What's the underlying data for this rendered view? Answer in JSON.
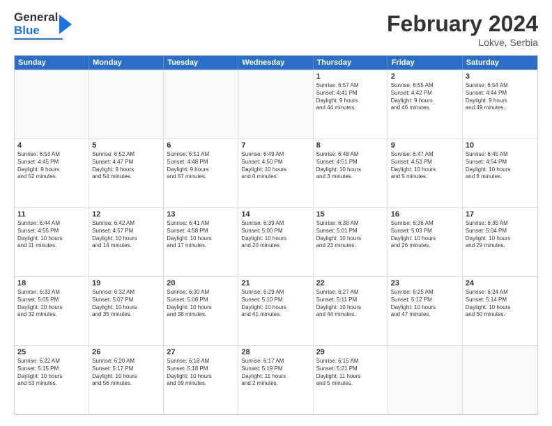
{
  "header": {
    "logo_general": "General",
    "logo_blue": "Blue",
    "main_title": "February 2024",
    "subtitle": "Lokve, Serbia"
  },
  "calendar": {
    "days": [
      "Sunday",
      "Monday",
      "Tuesday",
      "Wednesday",
      "Thursday",
      "Friday",
      "Saturday"
    ],
    "rows": [
      [
        {
          "day": "",
          "empty": true,
          "info": ""
        },
        {
          "day": "",
          "empty": true,
          "info": ""
        },
        {
          "day": "",
          "empty": true,
          "info": ""
        },
        {
          "day": "",
          "empty": true,
          "info": ""
        },
        {
          "day": "1",
          "info": "Sunrise: 6:57 AM\nSunset: 4:41 PM\nDaylight: 9 hours\nand 44 minutes."
        },
        {
          "day": "2",
          "info": "Sunrise: 6:55 AM\nSunset: 4:42 PM\nDaylight: 9 hours\nand 46 minutes."
        },
        {
          "day": "3",
          "info": "Sunrise: 6:54 AM\nSunset: 4:44 PM\nDaylight: 9 hours\nand 49 minutes."
        }
      ],
      [
        {
          "day": "4",
          "info": "Sunrise: 6:53 AM\nSunset: 4:45 PM\nDaylight: 9 hours\nand 52 minutes."
        },
        {
          "day": "5",
          "info": "Sunrise: 6:52 AM\nSunset: 4:47 PM\nDaylight: 9 hours\nand 54 minutes."
        },
        {
          "day": "6",
          "info": "Sunrise: 6:51 AM\nSunset: 4:48 PM\nDaylight: 9 hours\nand 57 minutes."
        },
        {
          "day": "7",
          "info": "Sunrise: 6:49 AM\nSunset: 4:50 PM\nDaylight: 10 hours\nand 0 minutes."
        },
        {
          "day": "8",
          "info": "Sunrise: 6:48 AM\nSunset: 4:51 PM\nDaylight: 10 hours\nand 3 minutes."
        },
        {
          "day": "9",
          "info": "Sunrise: 6:47 AM\nSunset: 4:53 PM\nDaylight: 10 hours\nand 5 minutes."
        },
        {
          "day": "10",
          "info": "Sunrise: 6:45 AM\nSunset: 4:54 PM\nDaylight: 10 hours\nand 8 minutes."
        }
      ],
      [
        {
          "day": "11",
          "info": "Sunrise: 6:44 AM\nSunset: 4:55 PM\nDaylight: 10 hours\nand 11 minutes."
        },
        {
          "day": "12",
          "info": "Sunrise: 6:42 AM\nSunset: 4:57 PM\nDaylight: 10 hours\nand 14 minutes."
        },
        {
          "day": "13",
          "info": "Sunrise: 6:41 AM\nSunset: 4:58 PM\nDaylight: 10 hours\nand 17 minutes."
        },
        {
          "day": "14",
          "info": "Sunrise: 6:39 AM\nSunset: 5:00 PM\nDaylight: 10 hours\nand 20 minutes."
        },
        {
          "day": "15",
          "info": "Sunrise: 6:38 AM\nSunset: 5:01 PM\nDaylight: 10 hours\nand 23 minutes."
        },
        {
          "day": "16",
          "info": "Sunrise: 6:36 AM\nSunset: 5:03 PM\nDaylight: 10 hours\nand 26 minutes."
        },
        {
          "day": "17",
          "info": "Sunrise: 6:35 AM\nSunset: 5:04 PM\nDaylight: 10 hours\nand 29 minutes."
        }
      ],
      [
        {
          "day": "18",
          "info": "Sunrise: 6:33 AM\nSunset: 5:05 PM\nDaylight: 10 hours\nand 32 minutes."
        },
        {
          "day": "19",
          "info": "Sunrise: 6:32 AM\nSunset: 5:07 PM\nDaylight: 10 hours\nand 35 minutes."
        },
        {
          "day": "20",
          "info": "Sunrise: 6:30 AM\nSunset: 5:08 PM\nDaylight: 10 hours\nand 38 minutes."
        },
        {
          "day": "21",
          "info": "Sunrise: 6:29 AM\nSunset: 5:10 PM\nDaylight: 10 hours\nand 41 minutes."
        },
        {
          "day": "22",
          "info": "Sunrise: 6:27 AM\nSunset: 5:11 PM\nDaylight: 10 hours\nand 44 minutes."
        },
        {
          "day": "23",
          "info": "Sunrise: 6:25 AM\nSunset: 5:12 PM\nDaylight: 10 hours\nand 47 minutes."
        },
        {
          "day": "24",
          "info": "Sunrise: 6:24 AM\nSunset: 5:14 PM\nDaylight: 10 hours\nand 50 minutes."
        }
      ],
      [
        {
          "day": "25",
          "info": "Sunrise: 6:22 AM\nSunset: 5:15 PM\nDaylight: 10 hours\nand 53 minutes."
        },
        {
          "day": "26",
          "info": "Sunrise: 6:20 AM\nSunset: 5:17 PM\nDaylight: 10 hours\nand 56 minutes."
        },
        {
          "day": "27",
          "info": "Sunrise: 6:18 AM\nSunset: 5:18 PM\nDaylight: 10 hours\nand 59 minutes."
        },
        {
          "day": "28",
          "info": "Sunrise: 6:17 AM\nSunset: 5:19 PM\nDaylight: 11 hours\nand 2 minutes."
        },
        {
          "day": "29",
          "info": "Sunrise: 6:15 AM\nSunset: 5:21 PM\nDaylight: 11 hours\nand 5 minutes."
        },
        {
          "day": "",
          "empty": true,
          "info": ""
        },
        {
          "day": "",
          "empty": true,
          "info": ""
        }
      ]
    ]
  }
}
